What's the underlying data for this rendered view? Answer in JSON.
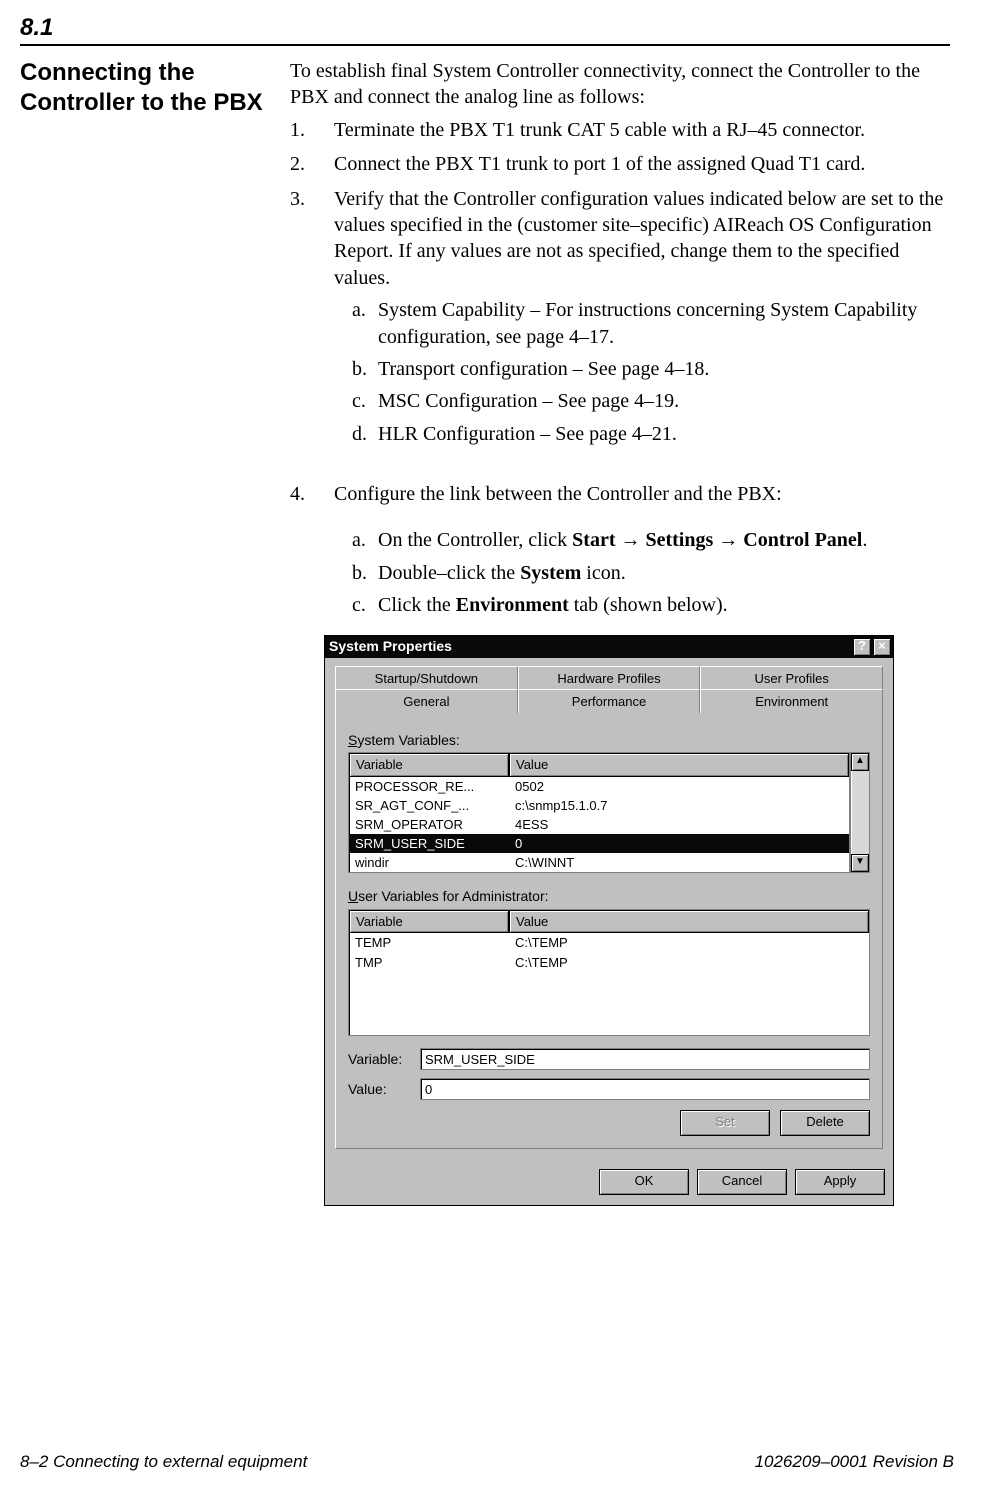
{
  "section_number": "8.1",
  "heading": "Connecting the Controller to the PBX",
  "intro": "To establish final System Controller connectivity, connect the Controller to the PBX and connect the analog line as follows:",
  "steps": {
    "s1_num": "1.",
    "s1": "Terminate the PBX T1 trunk CAT 5 cable with a RJ–45 connector.",
    "s2_num": "2.",
    "s2": "Connect the PBX T1 trunk to port 1 of the assigned Quad T1 card.",
    "s3_num": "3.",
    "s3": "Verify that the Controller configuration values indicated below are set to the values specified in the (customer site–specific) AIReach OS Configuration Report. If any values are not as specified, change them to the specified values.",
    "s3a_num": "a.",
    "s3a": "System Capability – For instructions concerning System Capability configuration, see page 4–17.",
    "s3b_num": "b.",
    "s3b": "Transport configuration – See page 4–18.",
    "s3c_num": "c.",
    "s3c": "MSC Configuration – See page 4–19.",
    "s3d_num": "d.",
    "s3d": "HLR Configuration – See page 4–21.",
    "s4_num": "4.",
    "s4": "Configure the link between the Controller and the PBX:",
    "s4a_num": "a.",
    "s4a_pre": "On the Controller, click ",
    "s4a_b1": "Start",
    "s4a_arr1": " → ",
    "s4a_b2": "Settings",
    "s4a_arr2": " → ",
    "s4a_b3": "Control Panel",
    "s4a_post": ".",
    "s4b_num": "b.",
    "s4b_pre": "Double–click the ",
    "s4b_b": "System",
    "s4b_post": " icon.",
    "s4c_num": "c.",
    "s4c_pre": "Click the ",
    "s4c_b": "Environment",
    "s4c_post": " tab (shown below)."
  },
  "dialog": {
    "title": "System Properties",
    "help_btn": "?",
    "close_btn": "×",
    "tabs_row1": [
      "Startup/Shutdown",
      "Hardware Profiles",
      "User Profiles"
    ],
    "tabs_row2": [
      "General",
      "Performance",
      "Environment"
    ],
    "sysvars_label_u": "S",
    "sysvars_label": "ystem Variables:",
    "col_var": "Variable",
    "col_val": "Value",
    "sys_rows": [
      {
        "var": "PROCESSOR_RE...",
        "val": "0502"
      },
      {
        "var": "SR_AGT_CONF_...",
        "val": "c:\\snmp15.1.0.7"
      },
      {
        "var": "SRM_OPERATOR",
        "val": "4ESS"
      },
      {
        "var": "SRM_USER_SIDE",
        "val": "0"
      },
      {
        "var": "windir",
        "val": "C:\\WINNT"
      }
    ],
    "sys_selected_index": 3,
    "uservars_label_u": "U",
    "uservars_label": "ser Variables for Administrator:",
    "user_rows": [
      {
        "var": "TEMP",
        "val": "C:\\TEMP"
      },
      {
        "var": "TMP",
        "val": "C:\\TEMP"
      }
    ],
    "variable_label_u": "V",
    "variable_label": "ariable:",
    "variable_value": "SRM_USER_SIDE",
    "value_label_u": "l",
    "value_label_pre": "Va",
    "value_label_post": "ue:",
    "value_value": "0",
    "set_btn_u": "S",
    "set_btn": "et",
    "delete_btn_u": "D",
    "delete_btn": "elete",
    "ok_btn": "OK",
    "cancel_btn": "Cancel",
    "apply_btn_u": "A",
    "apply_btn": "pply",
    "scroll_up": "▲",
    "scroll_down": "▼"
  },
  "footer": {
    "left": "8–2  Connecting to external equipment",
    "right": "1026209–0001  Revision B"
  }
}
